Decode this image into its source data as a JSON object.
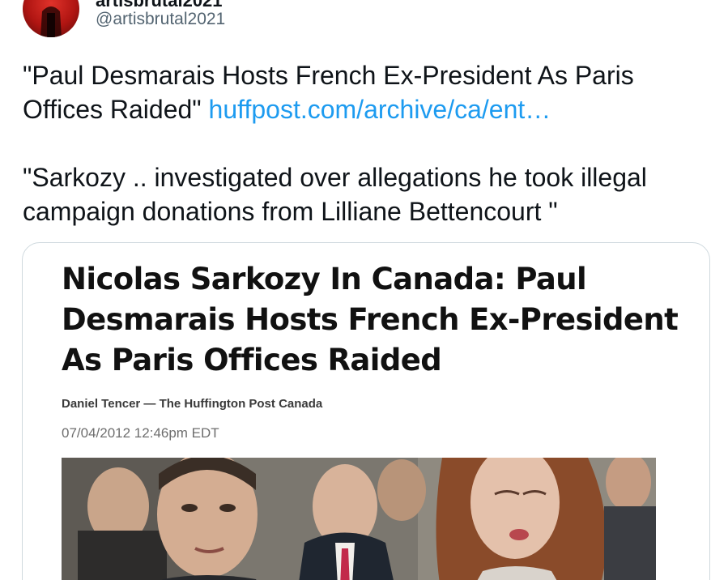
{
  "tweet": {
    "display_name": "artisbrutal2021",
    "handle": "@artisbrutal2021",
    "text_line1": "\"Paul Desmarais Hosts French Ex-President As Paris Offices Raided\"",
    "link_text": "huffpost.com/archive/ca/ent…",
    "text_line2": "\"Sarkozy .. investigated over allegations he took illegal campaign donations from Lilliane Bettencourt \""
  },
  "card": {
    "title": "Nicolas Sarkozy In Canada: Paul Desmarais Hosts French Ex-President As Paris Offices Raided",
    "byline": "Daniel Tencer — The Huffington Post Canada",
    "timestamp": "07/04/2012 12:46pm EDT"
  },
  "colors": {
    "link": "#1d9bf0",
    "handle": "#536471",
    "text": "#0f1419",
    "card_border": "#cfd9de"
  }
}
